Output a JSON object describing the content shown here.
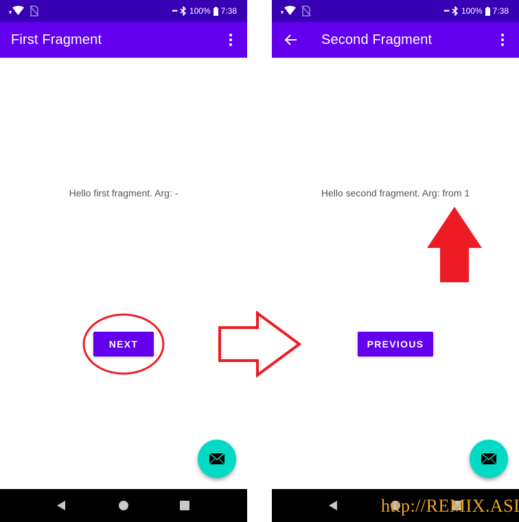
{
  "status_bar": {
    "battery": "100%",
    "time": "7:38"
  },
  "left_screen": {
    "title": "First Fragment",
    "message": "Hello first fragment. Arg: -",
    "button_label": "NEXT"
  },
  "right_screen": {
    "title": "Second Fragment",
    "message": "Hello second fragment. Arg: from 1",
    "button_label": "PREVIOUS"
  },
  "icons": {
    "overflow": "more-vert-icon",
    "back": "arrow-back-icon",
    "fab": "email-icon",
    "nav_back": "nav-back-icon",
    "nav_home": "nav-home-icon",
    "nav_recent": "nav-recents-icon"
  },
  "colors": {
    "status_bar": "#3700b3",
    "app_bar": "#6200ee",
    "button": "#6200ee",
    "fab": "#03dac5",
    "annotation": "#ed1c24"
  },
  "watermark": "http://REMIX.ASIA"
}
